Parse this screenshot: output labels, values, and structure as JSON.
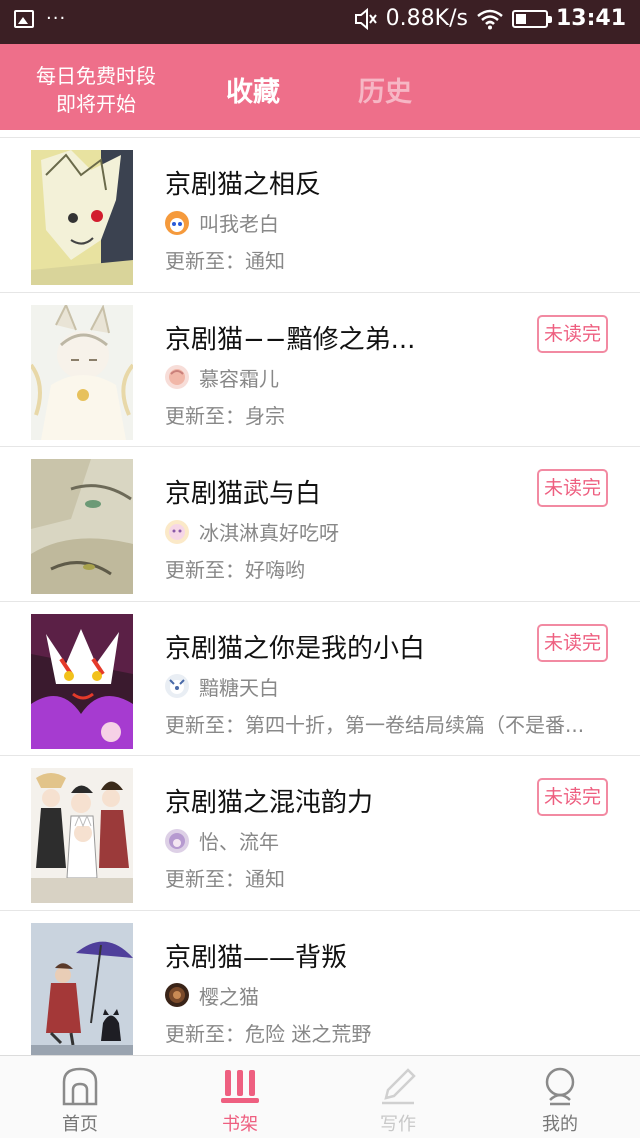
{
  "status_bar": {
    "dots": "···",
    "speed": "0.88K/s",
    "time": "13:41"
  },
  "header": {
    "free_notice_line1": "每日免费时段",
    "free_notice_line2": "即将开始",
    "tab_favorites": "收藏",
    "tab_history": "历史",
    "accent_color": "#ee6f8a"
  },
  "list": {
    "items": [
      {
        "title": "京剧猫之相反",
        "author": "叫我老白",
        "update": "更新至：通知",
        "badge": ""
      },
      {
        "title": "京剧猫−−黯修之弟...",
        "author": "慕容霜儿",
        "update": "更新至：身宗",
        "badge": "未读完"
      },
      {
        "title": "京剧猫武与白",
        "author": "冰淇淋真好吃呀",
        "update": "更新至：好嗨哟",
        "badge": "未读完"
      },
      {
        "title": "京剧猫之你是我的小白",
        "author": "黯糖天白",
        "update": "更新至：第四十折，第一卷结局续篇（不是番...",
        "badge": "未读完"
      },
      {
        "title": "京剧猫之混沌韵力",
        "author": "怡、流年",
        "update": "更新至：通知",
        "badge": "未读完"
      },
      {
        "title": "京剧猫——背叛",
        "author": "樱之猫",
        "update": "更新至：危险      迷之荒野",
        "badge": ""
      }
    ]
  },
  "bottom_nav": {
    "home": "首页",
    "bookshelf": "书架",
    "write": "写作",
    "mine": "我的",
    "active_color": "#ee5f80"
  }
}
